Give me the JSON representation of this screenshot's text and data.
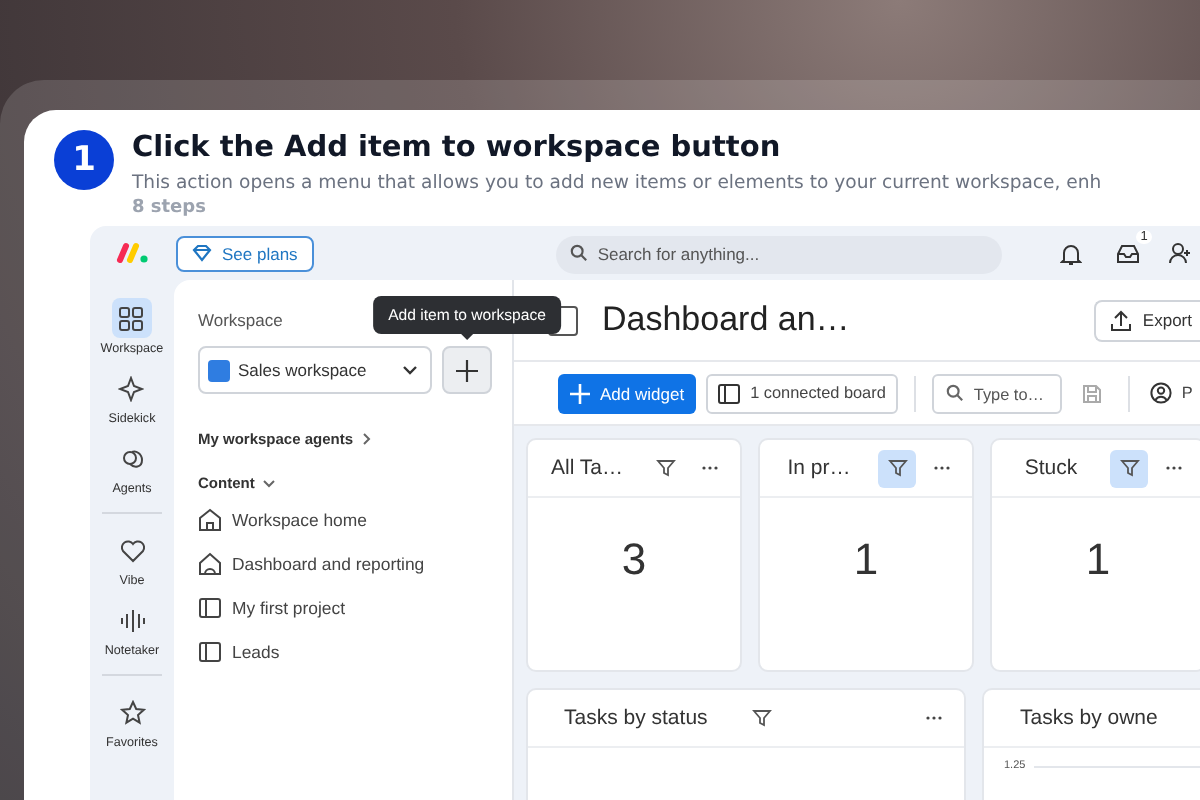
{
  "step": {
    "number": "1",
    "title": "Click the Add item to workspace button",
    "description": "This action opens a menu that allows you to add new items or elements to your current workspace, enh",
    "count": "8 steps"
  },
  "app": {
    "top_bar": {
      "plans_button": "See plans",
      "search": {
        "placeholder": "Search for anything..."
      },
      "inbox_badge": "1"
    },
    "rail_groups": [
      {
        "items": [
          {
            "label": "Workspace",
            "kind": "grid",
            "selected": true
          },
          {
            "label": "Sidekick",
            "kind": "sparkle",
            "selected": false
          },
          {
            "label": "Agents",
            "kind": "agents",
            "selected": false
          }
        ]
      },
      {
        "items": [
          {
            "label": "Vibe",
            "kind": "heart",
            "selected": false
          },
          {
            "label": "Notetaker",
            "kind": "wave",
            "selected": false
          }
        ]
      },
      {
        "items": [
          {
            "label": "Favorites",
            "kind": "star",
            "selected": false
          }
        ]
      }
    ],
    "sidebar": {
      "heading": "Workspace",
      "workspace_select": "Sales workspace",
      "agents_link": "My workspace agents",
      "section": {
        "label": "Content",
        "expanded": true
      },
      "items": [
        {
          "label": "Workspace home",
          "kind": "home"
        },
        {
          "label": "Dashboard and reporting",
          "kind": "dashboard"
        },
        {
          "label": "My first project",
          "kind": "board"
        },
        {
          "label": "Leads",
          "kind": "board"
        }
      ]
    },
    "tooltip": "Add item to workspace",
    "dashboard": {
      "title": "Dashboard an…",
      "export_button": "Export",
      "toolbar": {
        "add_button": "Add widget",
        "boards_button": "1 connected board",
        "search": {
          "placeholder": "Type to…"
        },
        "person_button": "P"
      },
      "number_widgets": [
        {
          "title": "All Ta…",
          "value": "3",
          "filter_active": false
        },
        {
          "title": "In pr…",
          "value": "1",
          "filter_active": true
        },
        {
          "title": "Stuck",
          "value": "1",
          "filter_active": true
        }
      ],
      "chart_widgets": [
        {
          "title": "Tasks by status",
          "filter_active": false
        },
        {
          "title": "Tasks by owne",
          "axis_tick": "1.25"
        }
      ]
    }
  }
}
